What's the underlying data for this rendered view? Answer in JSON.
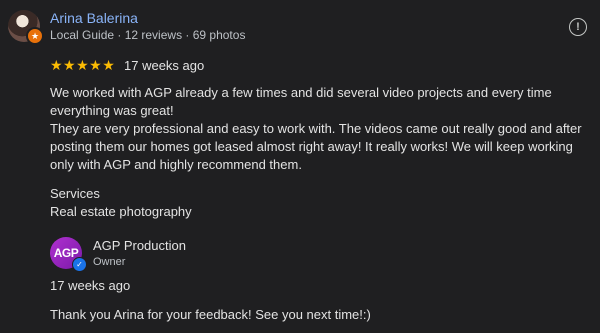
{
  "reviewer": {
    "name": "Arina Balerina",
    "meta": "Local Guide · 12 reviews · 69 photos",
    "avatar_icon": "reviewer-avatar",
    "badge_icon": "local-guide-star-icon"
  },
  "review": {
    "stars": "★★★★★",
    "rating": 5,
    "time": "17 weeks ago",
    "paragraph1": "We worked with AGP already a few times and did several video projects and every time everything was great!",
    "paragraph2": "They are very professional and easy to work with. The videos came out really good and after posting them our homes got leased almost right away! It really works! We will keep working only with AGP and highly recommend them.",
    "services_heading": "Services",
    "services_value": "Real estate photography"
  },
  "owner_reply": {
    "logo_text": "AGP",
    "name": "AGP Production",
    "role": "Owner",
    "time": "17 weeks ago",
    "text": "Thank you Arina for your feedback! See you next time!:)"
  },
  "icons": {
    "flag": "!",
    "badge": "★",
    "verified": "✓"
  },
  "colors": {
    "background": "#1f1f21",
    "name_link": "#8ab4f8",
    "stars": "#fbbc04",
    "badge": "#e8710a",
    "owner_logo": "#a228c8",
    "verified": "#1a73e8"
  }
}
